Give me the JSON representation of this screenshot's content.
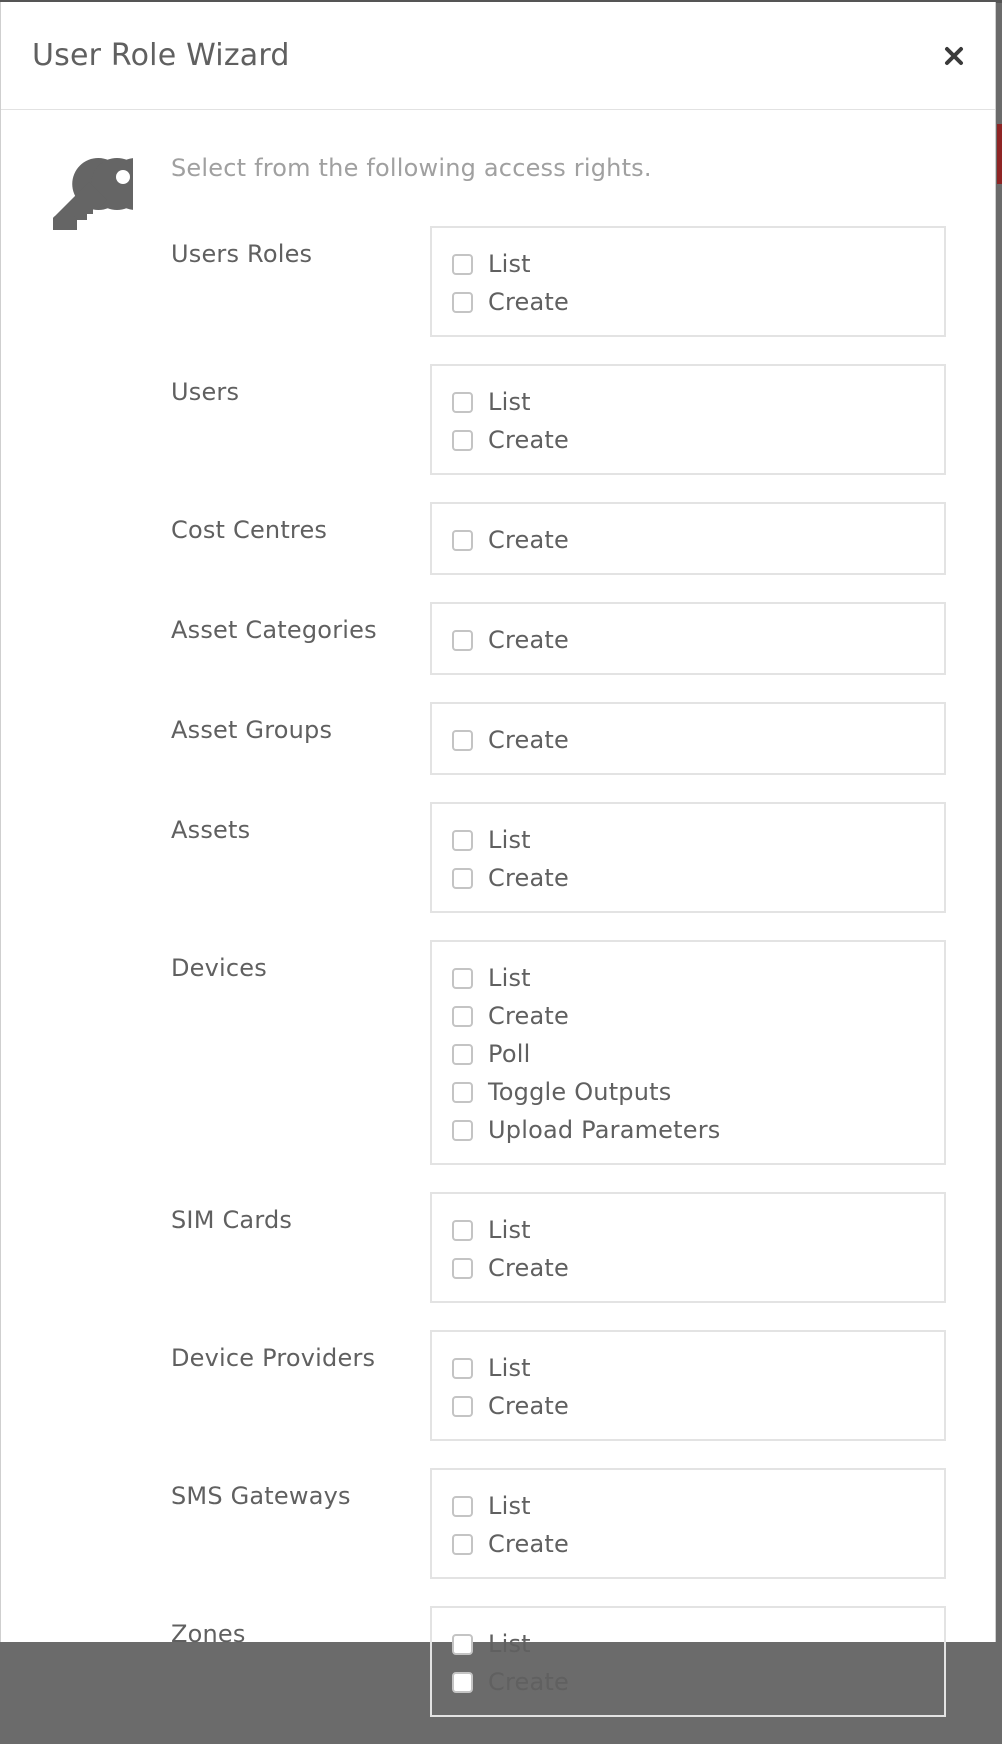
{
  "modal": {
    "title": "User Role Wizard",
    "close_label": "×",
    "intro": "Select from the following access rights.",
    "icon": "key-icon"
  },
  "rights": [
    {
      "label": "Users Roles",
      "options": [
        "List",
        "Create"
      ]
    },
    {
      "label": "Users",
      "options": [
        "List",
        "Create"
      ]
    },
    {
      "label": "Cost Centres",
      "options": [
        "Create"
      ]
    },
    {
      "label": "Asset Categories",
      "options": [
        "Create"
      ]
    },
    {
      "label": "Asset Groups",
      "options": [
        "Create"
      ]
    },
    {
      "label": "Assets",
      "options": [
        "List",
        "Create"
      ]
    },
    {
      "label": "Devices",
      "options": [
        "List",
        "Create",
        "Poll",
        "Toggle Outputs",
        "Upload Parameters"
      ]
    },
    {
      "label": "SIM Cards",
      "options": [
        "List",
        "Create"
      ]
    },
    {
      "label": "Device Providers",
      "options": [
        "List",
        "Create"
      ]
    },
    {
      "label": "SMS Gateways",
      "options": [
        "List",
        "Create"
      ]
    },
    {
      "label": "Zones",
      "options": [
        "List",
        "Create"
      ]
    }
  ],
  "colors": {
    "text": "#606060",
    "muted": "#a0a0a0",
    "border": "#e3e3e3",
    "checkbox_border": "#c4c4c4",
    "accent": "#8f2424"
  }
}
